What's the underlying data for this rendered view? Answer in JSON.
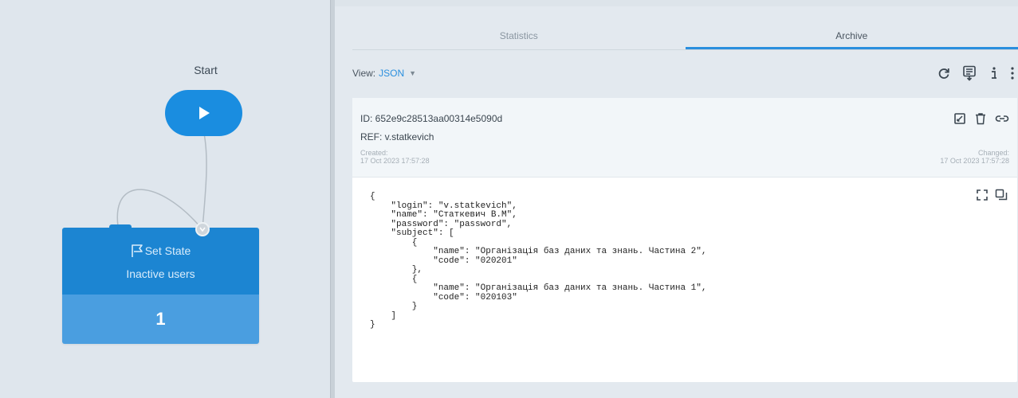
{
  "flow": {
    "start_label": "Start",
    "node": {
      "title": "Set State",
      "subtitle": "Inactive users",
      "count": "1"
    }
  },
  "panel": {
    "tabs": [
      {
        "label": "Statistics",
        "active": false
      },
      {
        "label": "Archive",
        "active": true
      }
    ],
    "view_label": "View:",
    "view_value": "JSON",
    "toolbar_icons": [
      "refresh-icon",
      "export-csv-icon",
      "info-icon",
      "more-vertical-icon"
    ]
  },
  "record": {
    "id": "ID: 652e9c28513aa00314e5090d",
    "ref": "REF: v.statkevich",
    "created_label": "Created:",
    "created": "17 Oct 2023 17:57:28",
    "changed_label": "Changed:",
    "changed": "17 Oct 2023 17:57:28",
    "actions": [
      "edit-icon",
      "delete-icon",
      "link-icon"
    ],
    "json_tools": [
      "expand-icon",
      "copy-icon"
    ],
    "json_text": "{\n    \"login\": \"v.statkevich\",\n    \"name\": \"Статкевич В.М\",\n    \"password\": \"password\",\n    \"subject\": [\n        {\n            \"name\": \"Організація баз даних та знань. Частина 2\",\n            \"code\": \"020201\"\n        },\n        {\n            \"name\": \"Організація баз даних та знань. Частина 1\",\n            \"code\": \"020103\"\n        }\n    ]\n}"
  },
  "colors": {
    "accent": "#1a8de0",
    "node_top": "#1c85d2",
    "node_bottom": "#4a9ee0",
    "background": "#dfe6ed"
  }
}
